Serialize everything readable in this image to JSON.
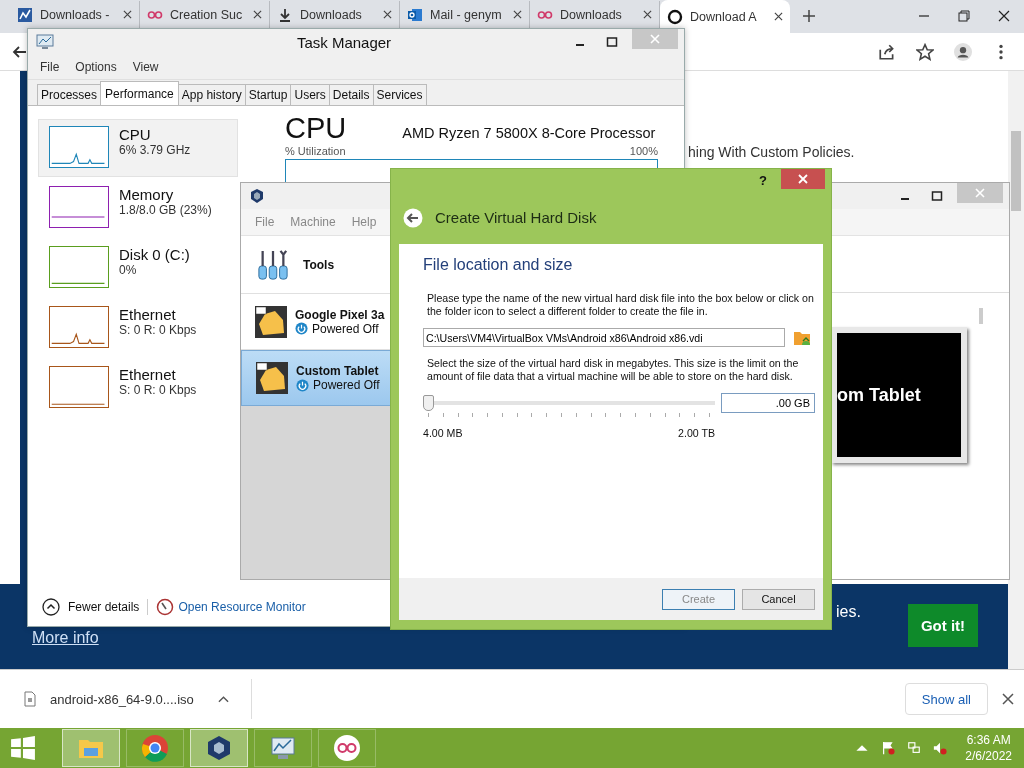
{
  "browser": {
    "tabs": [
      {
        "kind": "chart",
        "title": "Downloads -",
        "selected": false
      },
      {
        "kind": "rings",
        "title": "Creation Suc",
        "selected": false
      },
      {
        "kind": "download",
        "title": "Downloads",
        "selected": false
      },
      {
        "kind": "mail",
        "title": "Mail - genym",
        "selected": false
      },
      {
        "kind": "rings",
        "title": "Downloads",
        "selected": false
      },
      {
        "kind": "ring",
        "title": "Download A",
        "selected": true
      }
    ],
    "page": {
      "heading": "hing With Custom Policies.",
      "banner_text": "ies.",
      "banner_link": "More info",
      "banner_button": "Got it!"
    },
    "downloads": {
      "file": "android-x86_64-9.0....iso",
      "show_all": "Show all"
    }
  },
  "task_manager": {
    "title": "Task Manager",
    "menu": [
      "File",
      "Options",
      "View"
    ],
    "tabs": [
      {
        "label": "Processes",
        "selected": false
      },
      {
        "label": "Performance",
        "selected": true
      },
      {
        "label": "App history",
        "selected": false
      },
      {
        "label": "Startup",
        "selected": false
      },
      {
        "label": "Users",
        "selected": false
      },
      {
        "label": "Details",
        "selected": false
      },
      {
        "label": "Services",
        "selected": false
      }
    ],
    "resources": [
      {
        "kind": "spiky",
        "name": "CPU",
        "detail": "6% 3.79 GHz",
        "color": "#1f86b8",
        "selected": true
      },
      {
        "kind": "filled",
        "name": "Memory",
        "detail": "1.8/8.0 GB (23%)",
        "color": "#8e1fb0",
        "selected": false
      },
      {
        "kind": "dots",
        "name": "Disk 0 (C:)",
        "detail": "0%",
        "color": "#5a9e1e",
        "selected": false
      },
      {
        "kind": "spiky",
        "name": "Ethernet",
        "detail": "S: 0 R: 0 Kbps",
        "color": "#a8561a",
        "selected": false
      },
      {
        "kind": "flat",
        "name": "Ethernet",
        "detail": "S: 0 R: 0 Kbps",
        "color": "#a8561a",
        "selected": false
      }
    ],
    "panel": {
      "title": "CPU",
      "processor": "AMD Ryzen 7 5800X 8-Core Processor",
      "graph_label": "% Utilization",
      "graph_max": "100%"
    },
    "footer": {
      "fewer": "Fewer details",
      "monitor": "Open Resource Monitor"
    }
  },
  "virtualbox": {
    "menu": [
      "File",
      "Machine",
      "Help"
    ],
    "machines": [
      {
        "kind": "tools",
        "name": "Tools",
        "selected": false
      },
      {
        "kind": "vm",
        "name": "Google Pixel 3a",
        "status": "Powered Off",
        "selected": false
      },
      {
        "kind": "vm",
        "name": "Custom Tablet",
        "status": "Powered Off",
        "selected": true
      }
    ],
    "preview": "om Tablet"
  },
  "dialog": {
    "help": "?",
    "title": "Create Virtual Hard Disk",
    "section": "File location and size",
    "intro": "Please type the name of the new virtual hard disk file into the box below or click on the folder icon to select a different folder to create the file in.",
    "path": "C:\\Users\\VM4\\VirtualBox VMs\\Android x86\\Android x86.vdi",
    "size_intro": "Select the size of the virtual hard disk in megabytes. This size is the limit on the amount of file data that a virtual machine will be able to store on the hard disk.",
    "slider": {
      "level": 0,
      "min": "4.00 MB",
      "max": "2.00 TB"
    },
    "size": ".00 GB",
    "buttons": [
      {
        "label": "Create",
        "disabled": true
      },
      {
        "label": "Cancel",
        "disabled": false
      }
    ]
  },
  "taskbar": {
    "apps": [
      {
        "kind": "explorer",
        "active": true
      },
      {
        "kind": "chrome",
        "active": false
      },
      {
        "kind": "vbox",
        "active": true
      },
      {
        "kind": "taskmgr",
        "active": false
      },
      {
        "kind": "rings",
        "active": false
      }
    ],
    "time": "6:36 AM",
    "date": "2/6/2022"
  }
}
